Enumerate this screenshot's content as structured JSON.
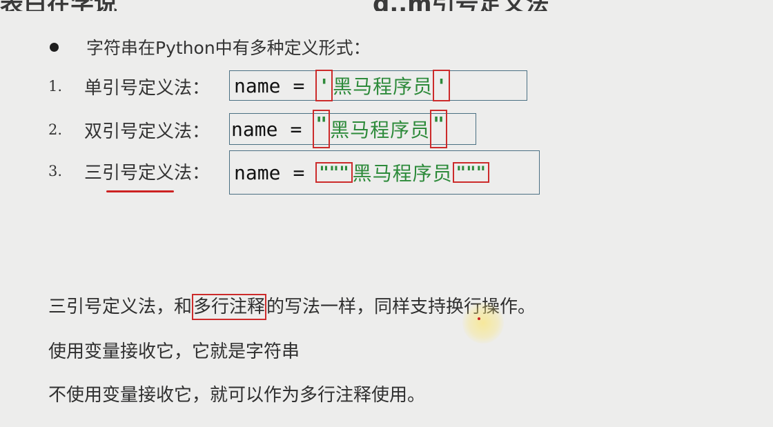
{
  "header": {
    "title_left": "表白在学说",
    "title_right": "d..m引号定义法"
  },
  "intro": {
    "text": "字符串在Python中有多种定义形式："
  },
  "definitions": [
    {
      "number": "1.",
      "label": "单引号定义法：",
      "code_name": "name",
      "code_eq": "=",
      "quote_open": "'",
      "string": "黑马程序员",
      "quote_close": "'"
    },
    {
      "number": "2.",
      "label": "双引号定义法：",
      "code_name": "name",
      "code_eq": "=",
      "quote_open": "\"",
      "string": "黑马程序员",
      "quote_close": "\""
    },
    {
      "number": "3.",
      "label": "三引号定义法：",
      "code_name": "name",
      "code_eq": "=",
      "quote_open": "\"\"\"",
      "string": "黑马程序员",
      "quote_close": "\"\"\""
    }
  ],
  "notes": {
    "line1_before": "三引号定义法，和",
    "line1_highlight": "多行注释",
    "line1_after": "的写法一样，同样支持换行操作。",
    "line2": "使用变量接收它，它就是字符串",
    "line3": "不使用变量接收它，就可以作为多行注释使用。"
  },
  "colors": {
    "background": "#ededec",
    "code_string": "#2d8a3a",
    "highlight_box": "#cc2a2a",
    "code_box_border": "#4a6f82"
  }
}
